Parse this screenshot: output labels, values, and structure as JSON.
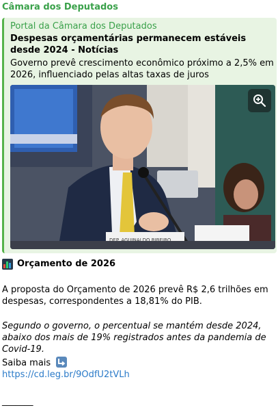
{
  "channel": {
    "name": "Câmara dos Deputados"
  },
  "preview": {
    "site_name": "Portal da Câmara dos Deputados",
    "title": "Despesas orçamentárias permanecem estáveis desde 2024 - Notícias",
    "description": "Governo prevê crescimento econômico próximo a 2,5% em 2026, influenciado pelas altas taxas de juros",
    "zoom_icon": "zoom-in-icon",
    "photo_nameplate": "DEP. AGUINALDO RIBEIRO"
  },
  "post": {
    "heading_icon": "bar-chart-icon",
    "heading": "Orçamento de 2026",
    "paragraph1": "A proposta do Orçamento de 2026 prevê R$ 2,6 trilhões em despesas, correspondentes a 18,81% do PIB.",
    "paragraph2": "Segundo o governo, o percentual se mantém desde 2024, abaixo dos mais de 19% registrados antes da pandemia de Covid-19.",
    "more_label": "Saiba mais",
    "more_icon": "arrow-down-right-icon",
    "link": "https://cd.leg.br/9OdfU2tVLh",
    "divider": "_______"
  },
  "colors": {
    "channel_green": "#3aa14a",
    "preview_bg": "#e8f4e3",
    "preview_border": "#55b24a",
    "link_blue": "#2a7ac8"
  }
}
